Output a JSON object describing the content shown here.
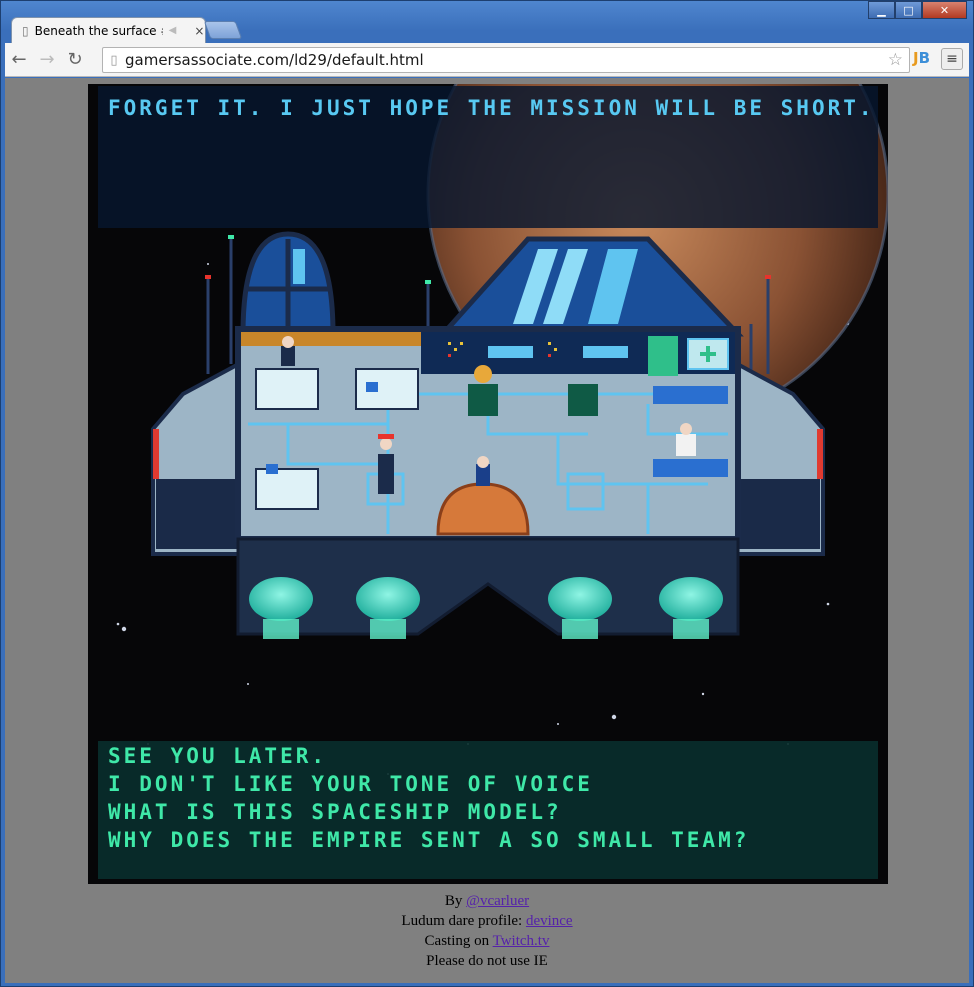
{
  "window": {
    "tab_title": "Beneath the surface #L",
    "tab_close": "×",
    "controls": {
      "minimize": "▁",
      "maximize": "□",
      "close": "✕"
    }
  },
  "toolbar": {
    "url": "gamersassociate.com/ld29/default.html",
    "back_icon": "arrow-left-icon",
    "forward_icon": "arrow-right-icon",
    "reload_icon": "reload-icon",
    "extension_label": "JB"
  },
  "game": {
    "top_dialog": "FORGET IT. I JUST HOPE THE MISSION WILL BE SHORT.",
    "options": [
      "SEE YOU LATER.",
      "I DON'T LIKE YOUR TONE OF VOICE",
      "WHAT IS THIS SPACESHIP MODEL?",
      "WHY DOES THE EMPIRE SENT A SO SMALL TEAM?"
    ],
    "colors": {
      "dialog_text": "#58c9f2",
      "option_text": "#3fe8a8",
      "hull": "#9db5c6",
      "glass": "#5fc4f0"
    }
  },
  "footer": {
    "by_prefix": "By ",
    "author_link": "@vcarluer",
    "profile_prefix": "Ludum dare profile: ",
    "profile_link": "devince",
    "casting_prefix": "Casting on ",
    "casting_link": "Twitch.tv",
    "warning": "Please do not use IE"
  }
}
